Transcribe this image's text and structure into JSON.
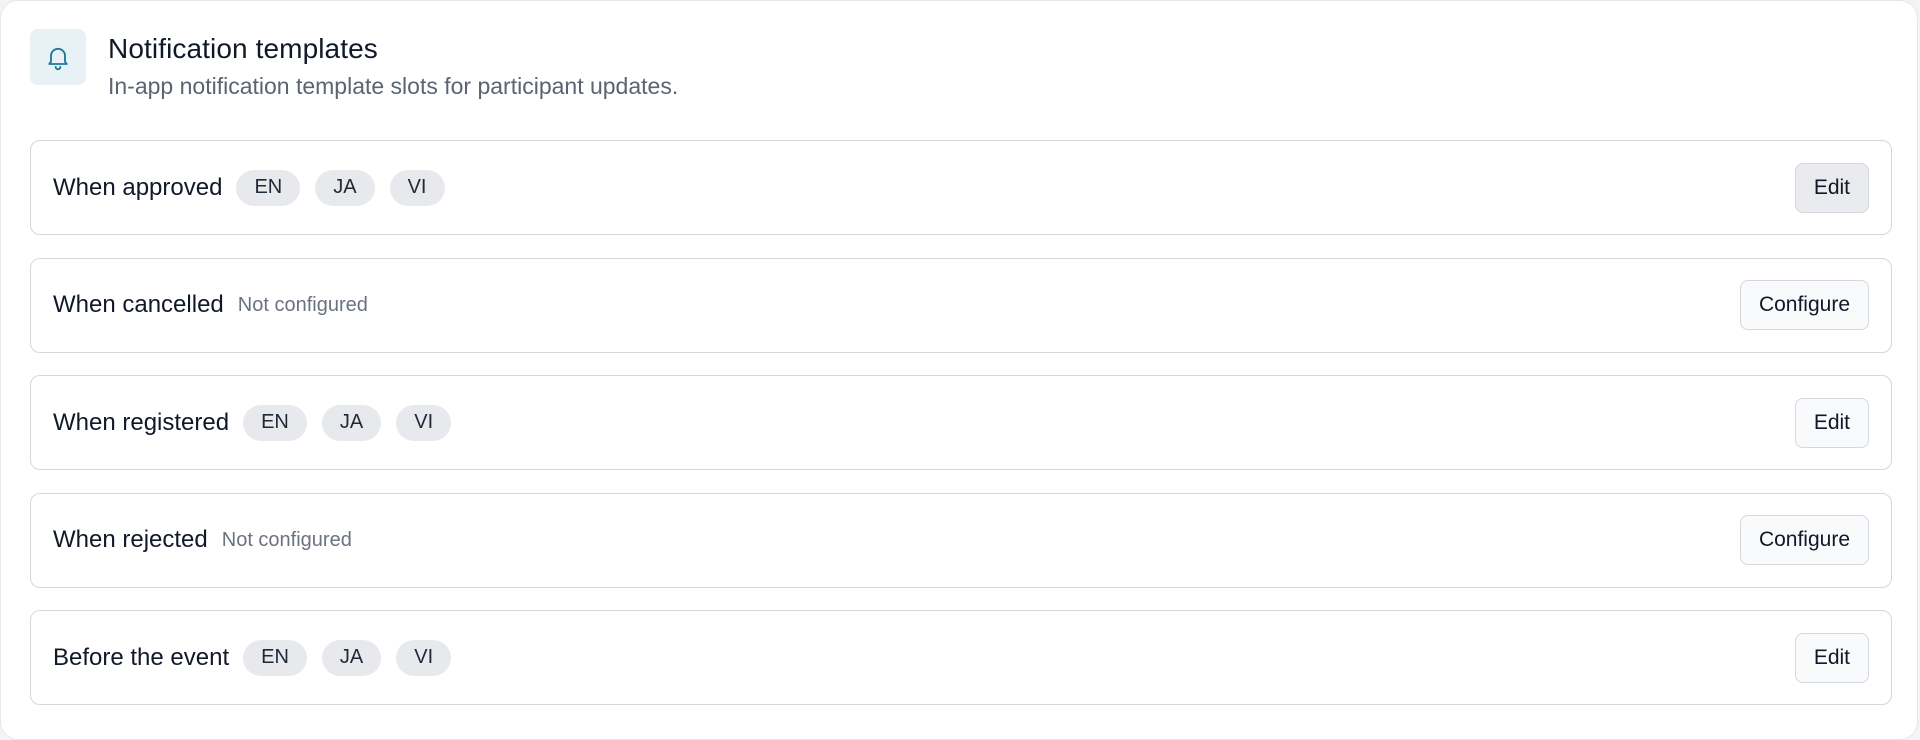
{
  "header": {
    "icon": "bell-icon",
    "icon_color": "#1d7a9a",
    "title": "Notification templates",
    "subtitle": "In-app notification template slots for participant updates."
  },
  "templates": [
    {
      "label": "When approved",
      "configured": true,
      "languages": [
        "EN",
        "JA",
        "VI"
      ],
      "action_label": "Edit",
      "status_text": ""
    },
    {
      "label": "When cancelled",
      "configured": false,
      "languages": [],
      "action_label": "Configure",
      "status_text": "Not configured"
    },
    {
      "label": "When registered",
      "configured": true,
      "languages": [
        "EN",
        "JA",
        "VI"
      ],
      "action_label": "Edit",
      "status_text": ""
    },
    {
      "label": "When rejected",
      "configured": false,
      "languages": [],
      "action_label": "Configure",
      "status_text": "Not configured"
    },
    {
      "label": "Before the event",
      "configured": true,
      "languages": [
        "EN",
        "JA",
        "VI"
      ],
      "action_label": "Edit",
      "status_text": ""
    }
  ]
}
